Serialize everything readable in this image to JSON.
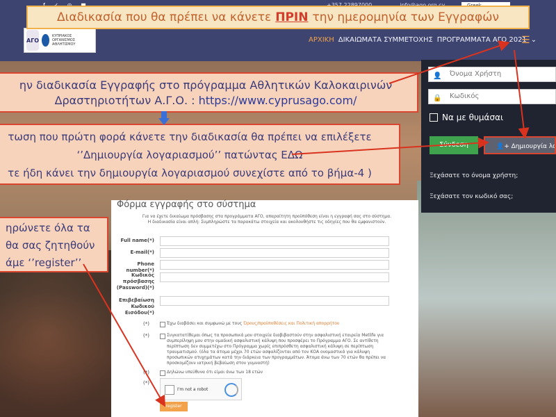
{
  "header": {
    "social": "f ✓ ◎ ■",
    "phone": "+357 22897000",
    "email": "info@ago.org.cy",
    "language": "Greek",
    "logo_text": "ΚΥΠΡΙΑΚΟΣ ΟΡΓΑΝΙΣΜΟΣ ΑΘΛΗΤΙΣΜΟΥ",
    "logo_short": "ΑΓΟ",
    "nav": [
      "ΑΡΧΙΚΗ",
      "ΔΙΚΑΙΩΜΑΤΑ ΣΥΜΜΕΤΟΧΗΣ",
      "ΠΡΟΓΡΑΜΜΑΤΑ ΑΓΟ 2021"
    ],
    "nav_caret": "⌄",
    "menu_icon": "hamburger-icon"
  },
  "banner": {
    "before": "Διαδικασία που θα πρέπει να κάνετε",
    "highlight": "ΠΡΙΝ",
    "after": "την ημερομηνία των Εγγραφών"
  },
  "callout1": {
    "line1": "ην διαδικασία Εγγραφής στο πρόγραμμα Αθλητικών Καλοκαιρινών",
    "line2": "Δραστηριοτήτων  Α.Γ.Ο. :",
    "url": "https://www.cyprusago.com/"
  },
  "callout2": {
    "line1": "τωση που πρώτη φορά κάνετε την διαδικασία θα πρέπει να επιλέξετε",
    "line2": "‘’Δημιουργία λογαριασμού’’ πατώντας ΕΔΩ",
    "line3": "τε ήδη κάνει την δημιουργία λογαριασμού συνεχίστε από το βήμα-4 )"
  },
  "callout3": {
    "line1": "ηρώνετε όλα τα",
    "line2": "θα σας ζητηθούν",
    "line3": "άμε ‘’register’’"
  },
  "login": {
    "username_placeholder": "Όνομα Χρήστη",
    "password_placeholder": "Κωδικός",
    "remember": "Να με θυμάσαι",
    "login_button": "Σύνδεση",
    "create_account": "Δημιουργία λογαριασμού",
    "forgot_username": "Ξεχάσατε το όνομα χρήστη;",
    "forgot_password": "Ξεχάσατε τον κωδικό σας;"
  },
  "form": {
    "title": "Φόρμα εγγραφής στο σύστημα",
    "intro1": "Για να έχετε δικαίωμα πρόσβασης στα προγράμματα ΑΓΟ, απαραίτητη προϋπόθεση είναι η εγγραφή σας στο σύστημα.",
    "intro2": "Η διαδικασία είναι απλή: Συμπληρώστε τα παρακάτω στοιχεία και ακολουθήστε τις οδηγίες που θα εμφανιστούν.",
    "fields": [
      "Full name(*)",
      "E-mail(*)",
      "Phone number(*)",
      "Κωδικός πρόσβασης (Password)(*)",
      "Επιβεβαίωση Κωδικού Εισόδου(*)"
    ],
    "required_mark": "(*)",
    "terms_prefix": "Έχω διαβάσει και συμφωνώ με τους",
    "terms_link": "Όρους/προϋποθέσεις και Πολιτική απορρήτου",
    "insurance": "Συγκατατίθεμαι όπως τα προσωπικά μου στοιχεία διαβιβαστούν στην ασφαλιστική εταιρεία Metlife για συμπερίληψη μου στην ομαδική ασφαλιστική κάλυψη που προσφέρει το Πρόγραμμα ΑΓΟ. Σε αντίθετη περίπτωση δεν συμμετέχω στο Πρόγραμμα χωρίς επιπρόσθετη ασφαλιστική κάλυψη σε περίπτωση τραυματισμού. (όλα τα άτομα μέχρι 70 ετών ασφαλίζονται από τον ΚΟΑ ονομαστικά για κάλυψη προσωπικών ατυχημάτων κατά την διάρκεια των προγραμμάτων. Άτομα άνω των 70 ετών θα πρέπει να προσκομίζουν ιατρική βεβαίωση στον γυμναστή)",
    "age": "Δηλώνω υπεύθυνα ότι είμαι άνω των 18 ετών",
    "captcha": "I'm not a robot",
    "captcha_brand": "reCAPTCHA",
    "register": "register"
  },
  "colors": {
    "topbar": "#3e4470",
    "accent": "#f1a24a",
    "callout_border": "#d9452e",
    "login_green": "#3fa34d"
  }
}
